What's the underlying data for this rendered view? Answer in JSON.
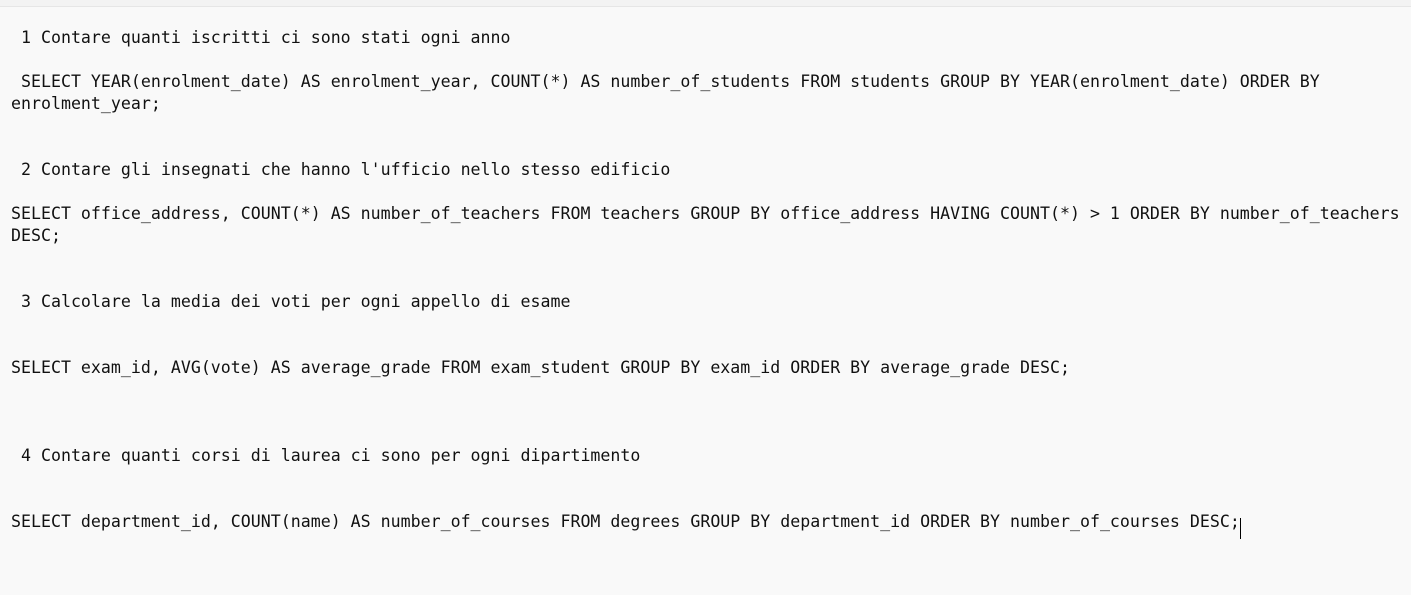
{
  "editor": {
    "lines": [
      " 1 Contare quanti iscritti ci sono stati ogni anno",
      " SELECT YEAR(enrolment_date) AS enrolment_year, COUNT(*) AS number_of_students FROM students GROUP BY YEAR(enrolment_date) ORDER BY",
      "enrolment_year;",
      " 2 Contare gli insegnati che hanno l'ufficio nello stesso edificio",
      "SELECT office_address, COUNT(*) AS number_of_teachers FROM teachers GROUP BY office_address HAVING COUNT(*) > 1 ORDER BY number_of_teachers",
      "DESC;",
      " 3 Calcolare la media dei voti per ogni appello di esame",
      "SELECT exam_id, AVG(vote) AS average_grade FROM exam_student GROUP BY exam_id ORDER BY average_grade DESC;",
      " 4 Contare quanti corsi di laurea ci sono per ogni dipartimento",
      "SELECT department_id, COUNT(name) AS number_of_courses FROM degrees GROUP BY department_id ORDER BY number_of_courses DESC;"
    ]
  }
}
